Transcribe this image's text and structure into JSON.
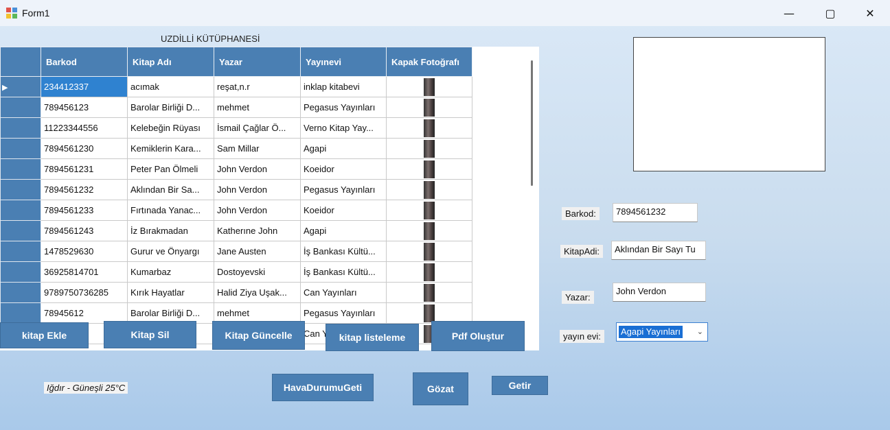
{
  "window": {
    "title": "Form1",
    "minimize": "—",
    "maximize": "▢",
    "close": "✕"
  },
  "form_title": "UZDİLLİ KÜTÜPHANESİ",
  "grid": {
    "columns": [
      "Barkod",
      "Kitap Adı",
      "Yazar",
      "Yayınevi",
      "Kapak Fotoğrafı"
    ],
    "rows": [
      {
        "barkod": "234412337",
        "kitap": "acımak",
        "yazar": "reşat,n.r",
        "yayinevi": "inklap kitabevi"
      },
      {
        "barkod": "789456123",
        "kitap": "Barolar Birliği D...",
        "yazar": "mehmet",
        "yayinevi": "Pegasus Yayınları"
      },
      {
        "barkod": "11223344556",
        "kitap": "Kelebeğin Rüyası",
        "yazar": "İsmail Çağlar Ö...",
        "yayinevi": "Verno Kitap Yay..."
      },
      {
        "barkod": "7894561230",
        "kitap": "Kemiklerin Kara...",
        "yazar": "Sam Millar",
        "yayinevi": "Agapi"
      },
      {
        "barkod": "7894561231",
        "kitap": "Peter Pan Ölmeli",
        "yazar": "John Verdon",
        "yayinevi": "Koeidor"
      },
      {
        "barkod": "7894561232",
        "kitap": "Aklından Bir Sa...",
        "yazar": "John Verdon",
        "yayinevi": "Pegasus Yayınları"
      },
      {
        "barkod": "7894561233",
        "kitap": "Fırtınada Yanac...",
        "yazar": "John Verdon",
        "yayinevi": "Koeidor"
      },
      {
        "barkod": "7894561243",
        "kitap": "İz Bırakmadan",
        "yazar": "Katherıne John",
        "yayinevi": "Agapi"
      },
      {
        "barkod": "1478529630",
        "kitap": "Gurur ve Önyargı",
        "yazar": "Jane Austen",
        "yayinevi": "İş Bankası Kültü..."
      },
      {
        "barkod": "36925814701",
        "kitap": "Kumarbaz",
        "yazar": "Dostoyevski",
        "yayinevi": "İş Bankası Kültü..."
      },
      {
        "barkod": "9789750736285",
        "kitap": "Kırık Hayatlar",
        "yazar": "Halid Ziya Uşak...",
        "yayinevi": "Can Yayınları"
      },
      {
        "barkod": "78945612",
        "kitap": "Barolar Birliği D...",
        "yazar": "mehmet",
        "yayinevi": "Pegasus Yayınları"
      },
      {
        "barkod": "11",
        "kitap": "",
        "yazar": "",
        "yayinevi": "Can Y"
      }
    ]
  },
  "buttons": {
    "kitap_ekle": "kitap Ekle",
    "kitap_sil": "Kitap Sil",
    "kitap_guncelle": "Kitap  Güncelle",
    "kitap_listeleme": "kitap listeleme",
    "pdf_olustur": "Pdf  Oluştur",
    "hava_durumu": "HavaDurumuGeti",
    "gozat": "Gözat",
    "getir": "Getir"
  },
  "fields": {
    "barkod_label": "Barkod:",
    "barkod_value": "7894561232",
    "kitapadi_label": "KitapAdi:",
    "kitapadi_value": "Aklından Bir Sayı Tu",
    "yazar_label": "Yazar:",
    "yazar_value": "John Verdon",
    "yayinevi_label": "yayın evi:",
    "yayinevi_value": "Agapi Yayınları"
  },
  "weather": "Iğdır - Güneşli 25°C"
}
